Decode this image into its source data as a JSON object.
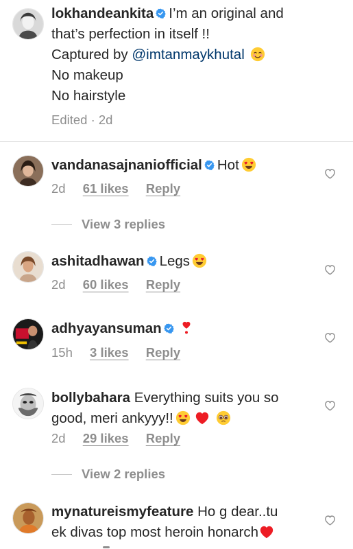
{
  "caption": {
    "username": "lokhandeankita",
    "lines": [
      "I’m an original and",
      "that’s perfection in itself !!",
      "Captured by ",
      "No makeup",
      "No hairstyle"
    ],
    "mention": "@imtanmaykhutal",
    "edited": "Edited · 2d"
  },
  "comments": [
    {
      "username": "vandanasajnaniofficial",
      "text": "Hot",
      "time": "2d",
      "likes": "61 likes",
      "reply": "Reply",
      "view_replies": "View 3 replies"
    },
    {
      "username": "ashitadhawan",
      "text": "Legs",
      "time": "2d",
      "likes": "60 likes",
      "reply": "Reply"
    },
    {
      "username": "adhyayansuman",
      "text": "",
      "time": "15h",
      "likes": "3 likes",
      "reply": "Reply"
    },
    {
      "username": "bollybahara",
      "text": "Everything suits you so",
      "text2": "good, meri ankyyy!!",
      "time": "2d",
      "likes": "29 likes",
      "reply": "Reply",
      "view_replies": "View 2 replies"
    },
    {
      "username": "mynatureismyfeature",
      "text": "Ho g dear..tu",
      "text2": "ek divas top most heroin honarch"
    }
  ],
  "colors": {
    "text": "#262626",
    "secondary": "#8e8e8e",
    "verified": "#3897f0",
    "heart_red": "#ed1c24",
    "mention": "#00376b"
  }
}
